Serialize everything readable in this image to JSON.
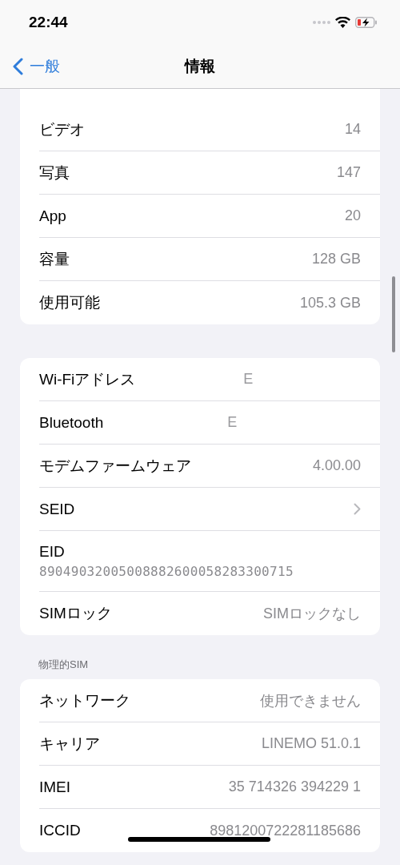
{
  "status_bar": {
    "time": "22:44"
  },
  "nav": {
    "back": "一般",
    "title": "情報"
  },
  "sections": [
    {
      "rows": [
        {
          "kind": "value",
          "label": "ビデオ",
          "value": "14"
        },
        {
          "kind": "value",
          "label": "写真",
          "value": "147"
        },
        {
          "kind": "value",
          "label": "App",
          "value": "20"
        },
        {
          "kind": "value",
          "label": "容量",
          "value": "128 GB"
        },
        {
          "kind": "value",
          "label": "使用可能",
          "value": "105.3 GB"
        }
      ]
    },
    {
      "rows": [
        {
          "kind": "faint",
          "label": "Wi-Fiアドレス",
          "value": "E"
        },
        {
          "kind": "faint",
          "label": "Bluetooth",
          "value": "E"
        },
        {
          "kind": "value",
          "label": "モデムファームウェア",
          "value": "4.00.00"
        },
        {
          "kind": "disclosure",
          "label": "SEID"
        },
        {
          "kind": "stacked",
          "label": "EID",
          "value": "89049032005008882600058283300715"
        },
        {
          "kind": "value",
          "label": "SIMロック",
          "value": "SIMロックなし"
        }
      ]
    },
    {
      "header": "物理的SIM",
      "rows": [
        {
          "kind": "value",
          "label": "ネットワーク",
          "value": "使用できません"
        },
        {
          "kind": "value",
          "label": "キャリア",
          "value": "LINEMO 51.0.1"
        },
        {
          "kind": "value",
          "label": "IMEI",
          "value": "35 714326 394229 1"
        },
        {
          "kind": "value",
          "label": "ICCID",
          "value": "8981200722281185686"
        }
      ]
    }
  ]
}
